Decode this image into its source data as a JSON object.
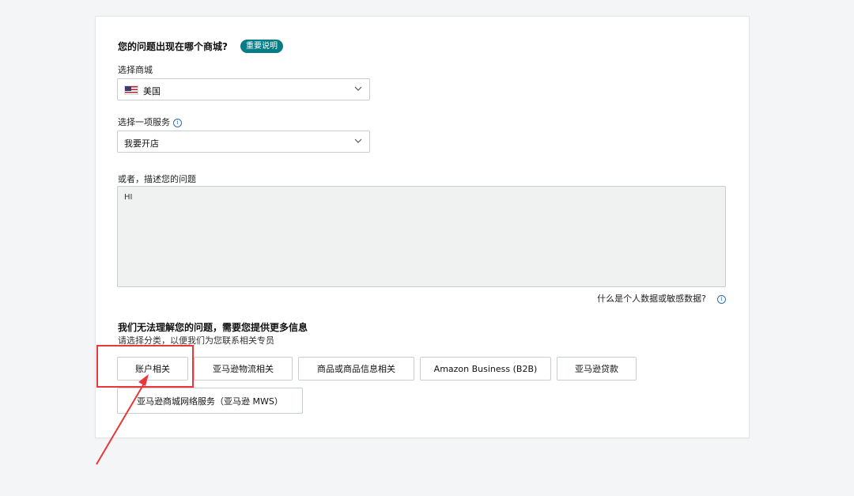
{
  "question": {
    "title": "您的问题出现在哪个商城?",
    "badge": "重要说明"
  },
  "marketplace": {
    "label": "选择商城",
    "selected": "美国",
    "flag_icon": "us-flag-icon"
  },
  "service": {
    "label": "选择一项服务",
    "selected": "我要开店"
  },
  "describe": {
    "label": "或者，描述您的问题",
    "value": "HI"
  },
  "privacy_link": "什么是个人数据或敏感数据?",
  "clarify": {
    "title": "我们无法理解您的问题，需要您提供更多信息",
    "subtitle": "请选择分类，以便我们为您联系相关专员"
  },
  "categories": [
    "账户相关",
    "亚马逊物流相关",
    "商品或商品信息相关",
    "Amazon Business (B2B)",
    "亚马逊贷款",
    "亚马逊商城网络服务（亚马逊 MWS）"
  ],
  "colors": {
    "badge": "#067d86",
    "annotation": "#e8383b",
    "background": "#f3f5f7"
  }
}
